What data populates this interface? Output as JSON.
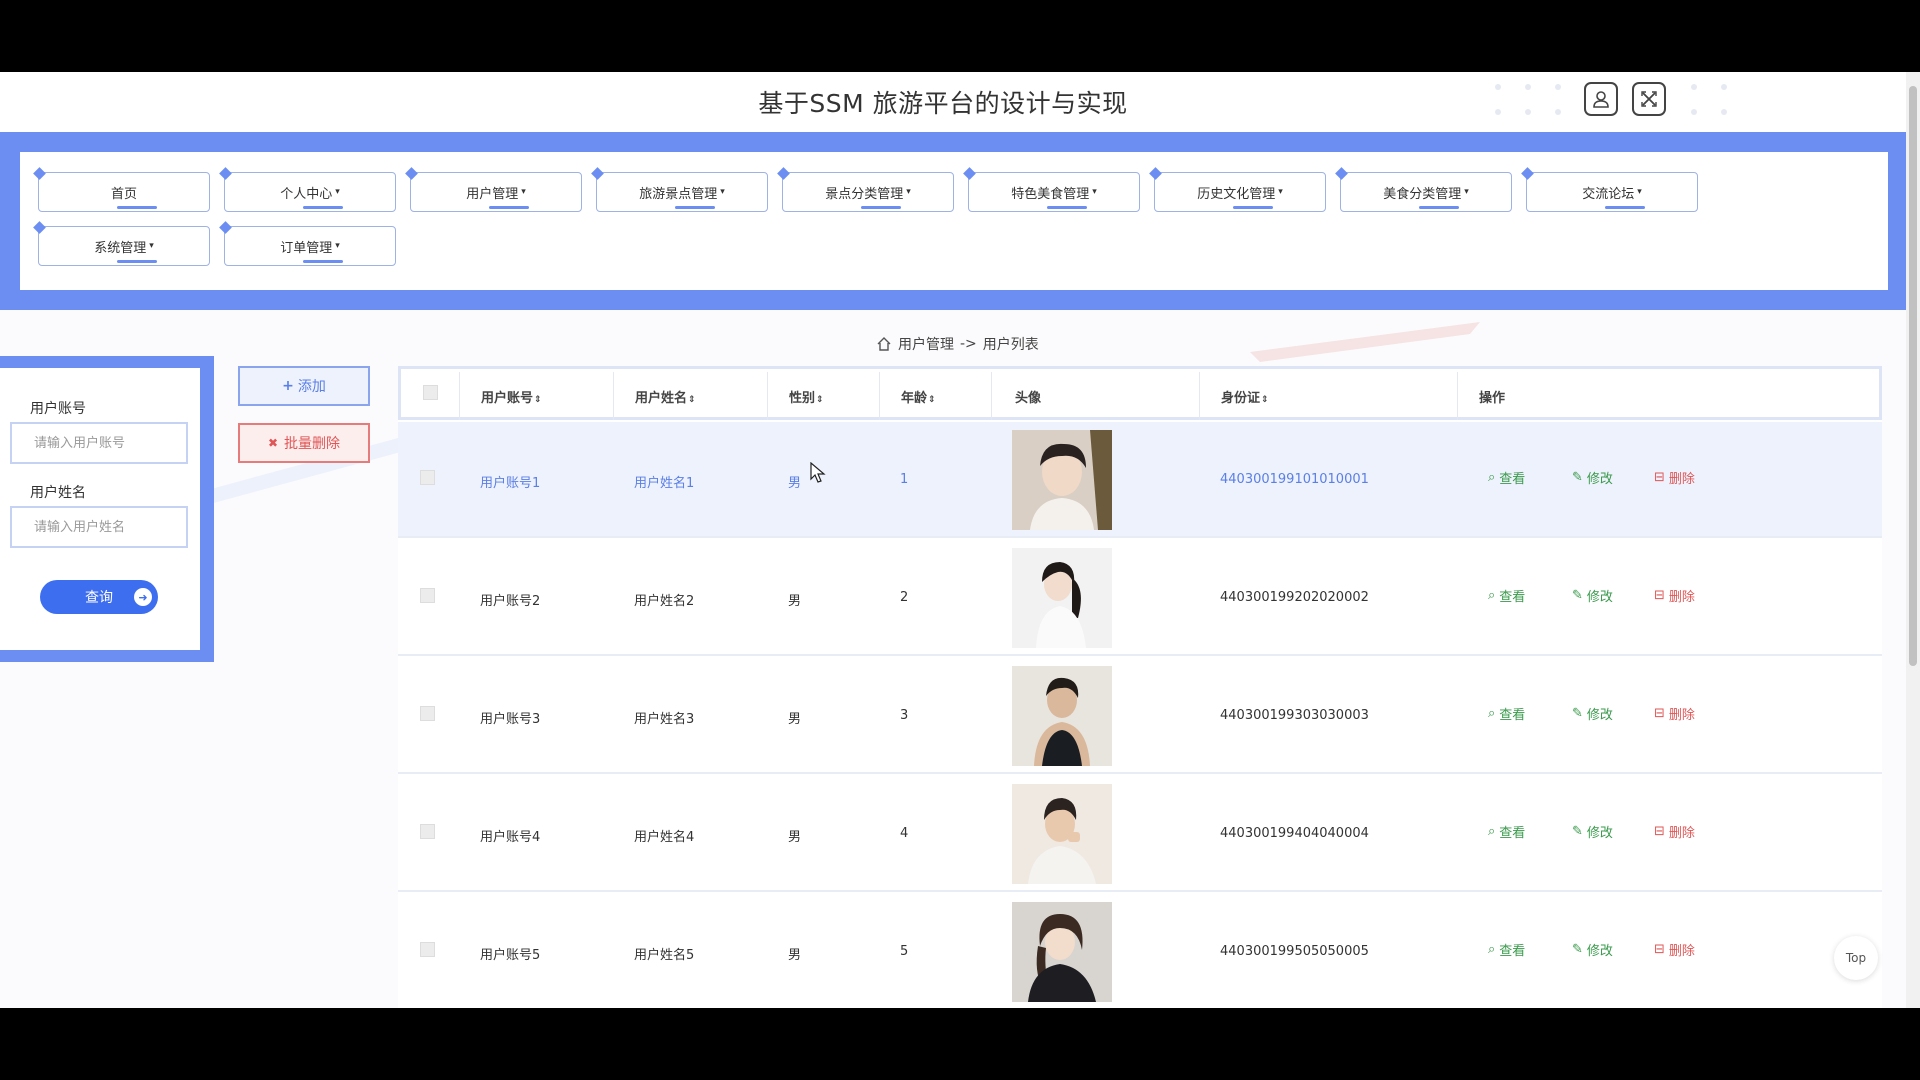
{
  "app": {
    "title": "基于SSM 旅游平台的设计与实现"
  },
  "header": {
    "profile_icon": "user-icon",
    "close_icon": "close-icon"
  },
  "nav": {
    "items": [
      {
        "label": "首页",
        "has_caret": false
      },
      {
        "label": "个人中心",
        "has_caret": true
      },
      {
        "label": "用户管理",
        "has_caret": true
      },
      {
        "label": "旅游景点管理",
        "has_caret": true
      },
      {
        "label": "景点分类管理",
        "has_caret": true
      },
      {
        "label": "特色美食管理",
        "has_caret": true
      },
      {
        "label": "历史文化管理",
        "has_caret": true
      },
      {
        "label": "美食分类管理",
        "has_caret": true
      },
      {
        "label": "交流论坛",
        "has_caret": true
      },
      {
        "label": "系统管理",
        "has_caret": true
      },
      {
        "label": "订单管理",
        "has_caret": true
      }
    ],
    "caret": "▾"
  },
  "breadcrumb": {
    "section": "用户管理",
    "separator": "->",
    "page": "用户列表"
  },
  "search": {
    "account_label": "用户账号",
    "account_placeholder": "请输入用户账号",
    "name_label": "用户姓名",
    "name_placeholder": "请输入用户姓名",
    "query_label": "查询"
  },
  "toolbar": {
    "add_label": "添加",
    "bulk_delete_label": "批量删除"
  },
  "table": {
    "headers": {
      "account": "用户账号",
      "name": "用户姓名",
      "gender": "性别",
      "age": "年龄",
      "avatar": "头像",
      "id_card": "身份证",
      "actions": "操作"
    },
    "sort_icon": "⇕",
    "action_labels": {
      "view": "查看",
      "edit": "修改",
      "delete": "删除"
    },
    "rows": [
      {
        "account": "用户账号1",
        "name": "用户姓名1",
        "gender": "男",
        "age": "1",
        "id_card": "440300199101010001"
      },
      {
        "account": "用户账号2",
        "name": "用户姓名2",
        "gender": "男",
        "age": "2",
        "id_card": "440300199202020002"
      },
      {
        "account": "用户账号3",
        "name": "用户姓名3",
        "gender": "男",
        "age": "3",
        "id_card": "440300199303030003"
      },
      {
        "account": "用户账号4",
        "name": "用户姓名4",
        "gender": "男",
        "age": "4",
        "id_card": "440300199404040004"
      },
      {
        "account": "用户账号5",
        "name": "用户姓名5",
        "gender": "男",
        "age": "5",
        "id_card": "440300199505050005"
      }
    ]
  },
  "back_to_top": "Top",
  "colors": {
    "accent": "#6c8ef3",
    "primary": "#3e6ef0",
    "danger": "#e05555",
    "success": "#3a9a4c"
  }
}
